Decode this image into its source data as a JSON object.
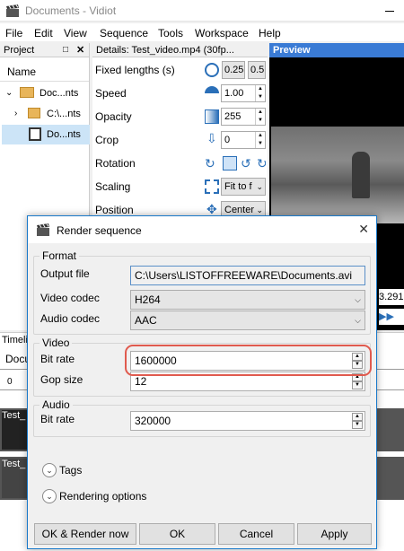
{
  "window": {
    "title": "Documents - Vidiot"
  },
  "menu": [
    "File",
    "Edit",
    "View",
    "Sequence",
    "Tools",
    "Workspace",
    "Help"
  ],
  "project": {
    "title": "Project",
    "column": "Name",
    "items": [
      "Doc...nts",
      "C:\\...nts",
      "Do...nts"
    ]
  },
  "details": {
    "title": "Details: Test_video.mp4 (30fp...",
    "rows": [
      {
        "label": "Fixed lengths (s)",
        "values": [
          "0.25",
          "0.5"
        ]
      },
      {
        "label": "Speed",
        "value": "1.00"
      },
      {
        "label": "Opacity",
        "value": "255"
      },
      {
        "label": "Crop",
        "value": "0"
      },
      {
        "label": "Rotation"
      },
      {
        "label": "Scaling",
        "value": "Fit to f"
      },
      {
        "label": "Position",
        "value": "Center"
      }
    ]
  },
  "preview": {
    "title": "Preview",
    "time_partial": "3.291"
  },
  "timeline": {
    "tab_partial": "Timelin",
    "seq_partial": "Docu",
    "ruler_zero": "0",
    "clips": [
      "Test_",
      "Test_"
    ]
  },
  "dialog": {
    "title": "Render sequence",
    "format": {
      "group": "Format",
      "output_label": "Output file",
      "output_value": "C:\\Users\\LISTOFFREEWARE\\Documents.avi",
      "vcodec_label": "Video codec",
      "vcodec_value": "H264",
      "acodec_label": "Audio codec",
      "acodec_value": "AAC"
    },
    "video": {
      "group": "Video",
      "bitrate_label": "Bit rate",
      "bitrate_value": "1600000",
      "gop_label": "Gop size",
      "gop_value": "12"
    },
    "audio": {
      "group": "Audio",
      "bitrate_label": "Bit rate",
      "bitrate_value": "320000"
    },
    "tags_label": "Tags",
    "rendering_label": "Rendering options",
    "buttons": {
      "render": "OK & Render now",
      "ok": "OK",
      "cancel": "Cancel",
      "apply": "Apply"
    }
  },
  "colors": {
    "accent": "#1979ca",
    "highlight": "#e05a4e",
    "preview_header": "#3a7bd5"
  }
}
